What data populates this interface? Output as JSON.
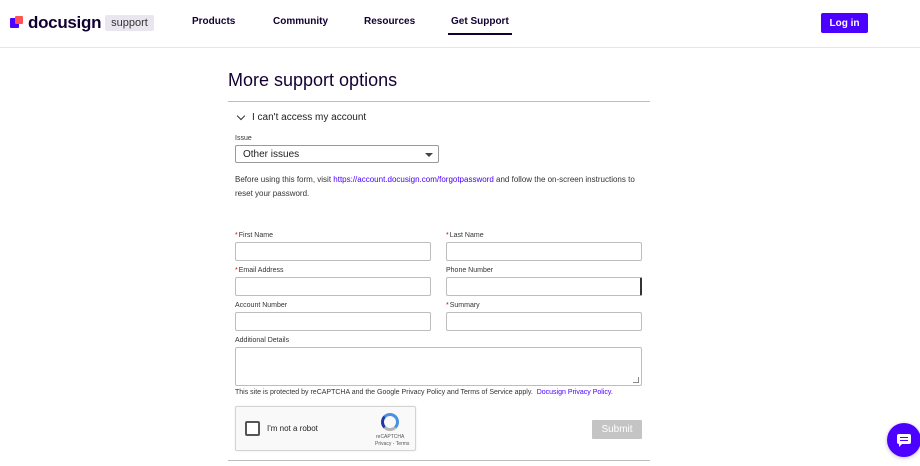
{
  "header": {
    "logo_text": "docusign",
    "logo_badge": "support",
    "nav": [
      {
        "label": "Products"
      },
      {
        "label": "Community"
      },
      {
        "label": "Resources"
      },
      {
        "label": "Get Support"
      }
    ],
    "login_label": "Log in"
  },
  "main": {
    "title": "More support options",
    "accordion_title": "I can't access my account",
    "issue_label": "Issue",
    "issue_value": "Other issues",
    "info_before": "Before using this form, visit ",
    "info_link": "https://account.docusign.com/forgotpassword",
    "info_after": " and follow the on-screen instructions to reset your password."
  },
  "form": {
    "required_mark": "*",
    "first_name": "First Name",
    "last_name": "Last Name",
    "email": "Email Address",
    "phone": "Phone Number",
    "account": "Account Number",
    "summary": "Summary",
    "details": "Additional Details",
    "recaptcha_note": "This site is protected by reCAPTCHA and the Google Privacy Policy and Terms of Service apply.",
    "privacy_link": "Docusign Privacy Policy.",
    "captcha_label": "I'm not a robot",
    "captcha_brand": "reCAPTCHA",
    "captcha_links": "Privacy - Terms",
    "submit_label": "Submit"
  },
  "colors": {
    "accent": "#4c00ff",
    "required": "#d50000",
    "submit_disabled": "#c4c4c4"
  }
}
